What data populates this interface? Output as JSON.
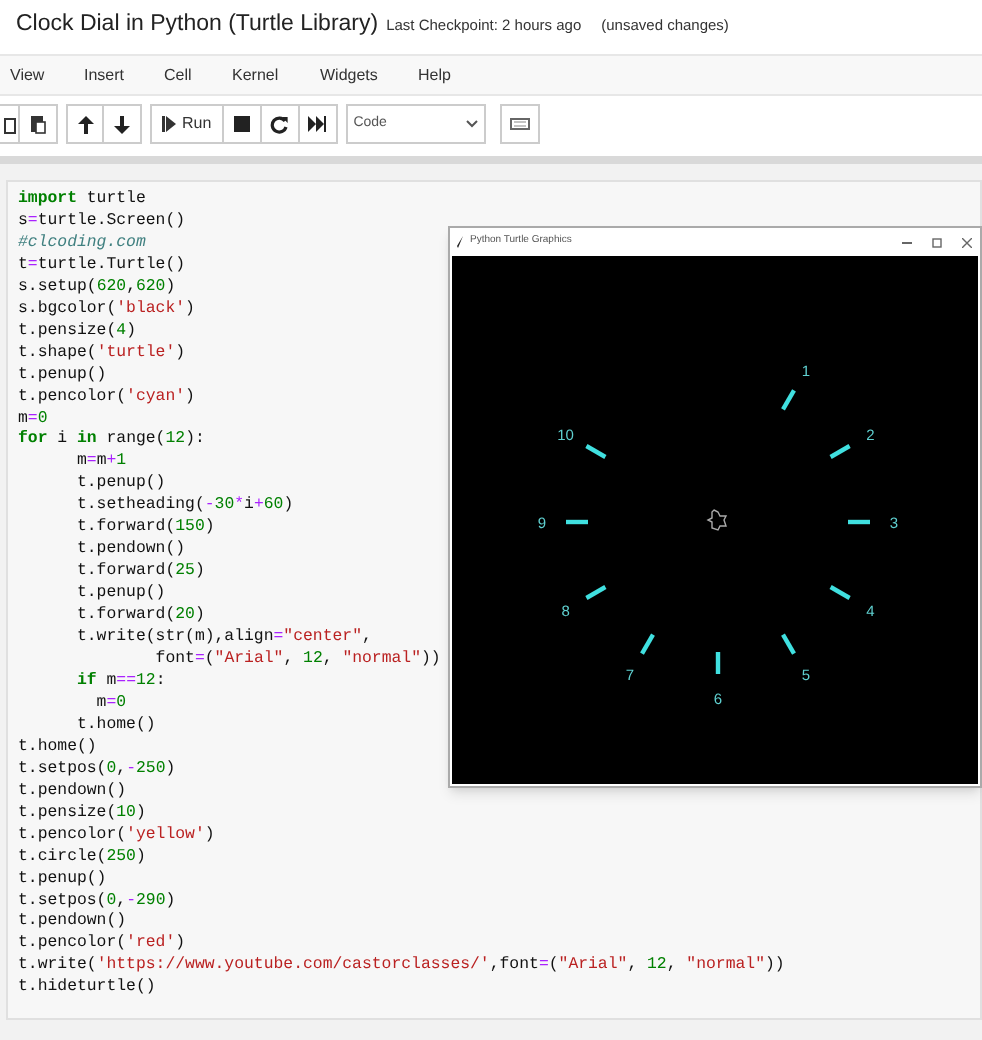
{
  "notebook": {
    "title": "Clock Dial in Python (Turtle Library)",
    "checkpoint": "Last Checkpoint: 2 hours ago",
    "save_status": "(unsaved changes)"
  },
  "menu": [
    "View",
    "Insert",
    "Cell",
    "Kernel",
    "Widgets",
    "Help"
  ],
  "toolbar": {
    "run_label": "Run",
    "cell_type": "Code"
  },
  "cell": {
    "lines": [
      "import turtle",
      "s=turtle.Screen()",
      "#clcoding.com",
      "t=turtle.Turtle()",
      "s.setup(620,620)",
      "s.bgcolor('black')",
      "t.pensize(4)",
      "t.shape('turtle')",
      "t.penup()",
      "t.pencolor('cyan')",
      "m=0",
      "for i in range(12):",
      "      m=m+1",
      "      t.penup()",
      "      t.setheading(-30*i+60)",
      "      t.forward(150)",
      "      t.pendown()",
      "      t.forward(25)",
      "      t.penup()",
      "      t.forward(20)",
      "      t.write(str(m),align=\"center\",",
      "              font=(\"Arial\", 12, \"normal\"))",
      "      if m==12:",
      "        m=0",
      "      t.home()",
      "t.home()",
      "t.setpos(0,-250)",
      "t.pendown()",
      "t.pensize(10)",
      "t.pencolor('yellow')",
      "t.circle(250)",
      "t.penup()",
      "t.setpos(0,-290)",
      "t.pendown()",
      "t.pencolor('red')",
      "t.write('https://www.youtube.com/castorclasses/',font=(\"Arial\", 12, \"normal\"))",
      "t.hideturtle()"
    ]
  },
  "turtle_window": {
    "title": "Python Turtle Graphics",
    "dial_labels": [
      "1",
      "2",
      "3",
      "4",
      "5",
      "6",
      "7",
      "8",
      "9",
      "10"
    ]
  }
}
